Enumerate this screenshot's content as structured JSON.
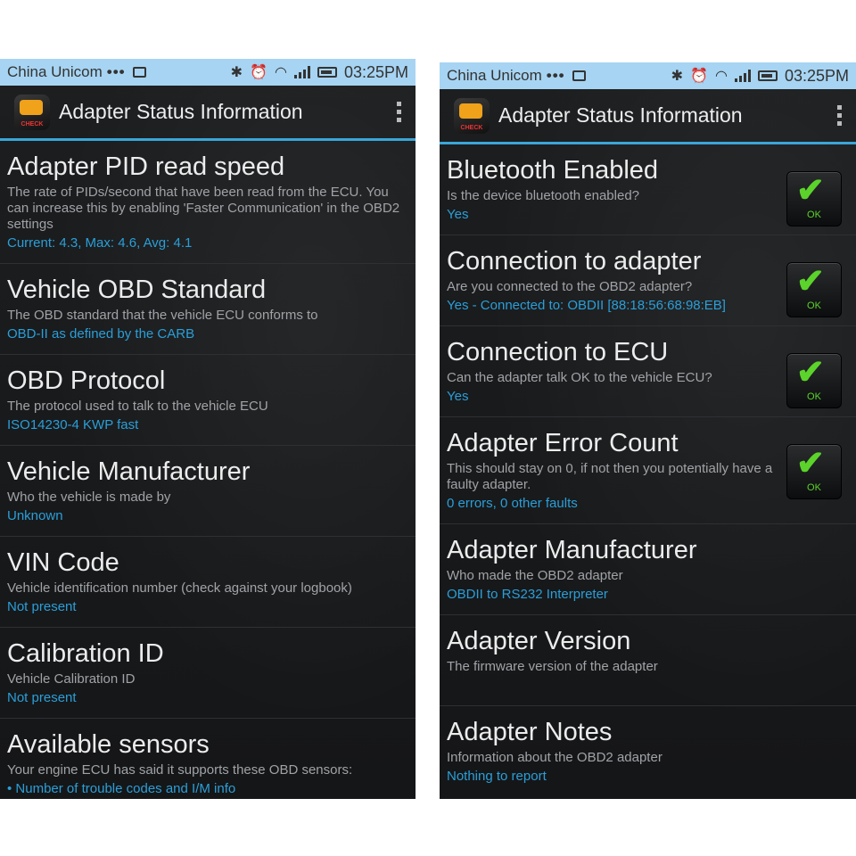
{
  "left": {
    "status": {
      "carrier": "China Unicom",
      "dots": "•••",
      "time": "03:25PM"
    },
    "app_title": "Adapter Status Information",
    "items": [
      {
        "title": "Adapter PID read speed",
        "desc": "The rate of PIDs/second that have been read from the ECU. You can increase this by enabling 'Faster Communication' in the OBD2 settings",
        "value": "Current: 4.3, Max: 4.6, Avg: 4.1"
      },
      {
        "title": "Vehicle OBD Standard",
        "desc": "The OBD standard that the vehicle ECU conforms to",
        "value": "OBD-II as defined by the CARB"
      },
      {
        "title": "OBD Protocol",
        "desc": "The protocol used to talk to the vehicle ECU",
        "value": "ISO14230-4 KWP fast"
      },
      {
        "title": "Vehicle Manufacturer",
        "desc": "Who the vehicle is made by",
        "value": "Unknown"
      },
      {
        "title": "VIN Code",
        "desc": "Vehicle identification number (check against your logbook)",
        "value": "Not present"
      },
      {
        "title": "Calibration ID",
        "desc": "Vehicle Calibration ID",
        "value": "Not present"
      },
      {
        "title": "Available sensors",
        "desc": "Your engine ECU has said it supports these OBD sensors:",
        "value": "• Number of trouble codes and I/M info"
      }
    ]
  },
  "right": {
    "status": {
      "carrier": "China Unicom",
      "dots": "•••",
      "time": "03:25PM"
    },
    "app_title": "Adapter Status Information",
    "ok_label": "OK",
    "items": [
      {
        "title": "Bluetooth Enabled",
        "desc": "Is the device bluetooth enabled?",
        "value": "Yes"
      },
      {
        "title": "Connection to adapter",
        "desc": "Are you connected to the OBD2 adapter?",
        "value": "Yes - Connected to: OBDII [88:18:56:68:98:EB]"
      },
      {
        "title": "Connection to ECU",
        "desc": "Can the adapter talk OK to the vehicle ECU?",
        "value": "Yes"
      },
      {
        "title": "Adapter Error Count",
        "desc": "This should stay on 0, if not then you potentially have a faulty adapter.",
        "value": "0 errors, 0 other faults"
      },
      {
        "title": "Adapter Manufacturer",
        "desc": "Who made the OBD2 adapter",
        "value": "OBDII to RS232 Interpreter"
      },
      {
        "title": "Adapter Version",
        "desc": "The firmware version of the adapter",
        "value": ""
      },
      {
        "title": "Adapter Notes",
        "desc": "Information about the OBD2 adapter",
        "value": "Nothing to report"
      }
    ]
  },
  "icons": {
    "app_icon": "obd-check-engine-icon",
    "status_icons": [
      "image-icon",
      "bluetooth-icon",
      "alarm-icon",
      "wifi-icon",
      "signal-icon",
      "battery-icon"
    ],
    "overflow_menu": "overflow-menu-icon",
    "ok_badge": "ok-check-icon"
  },
  "colors": {
    "statusbar": "#a7d4f2",
    "accent": "#3aa6d8",
    "value_text": "#2a9fd8",
    "ok_green": "#5bd32b",
    "background": "#191b1d"
  }
}
